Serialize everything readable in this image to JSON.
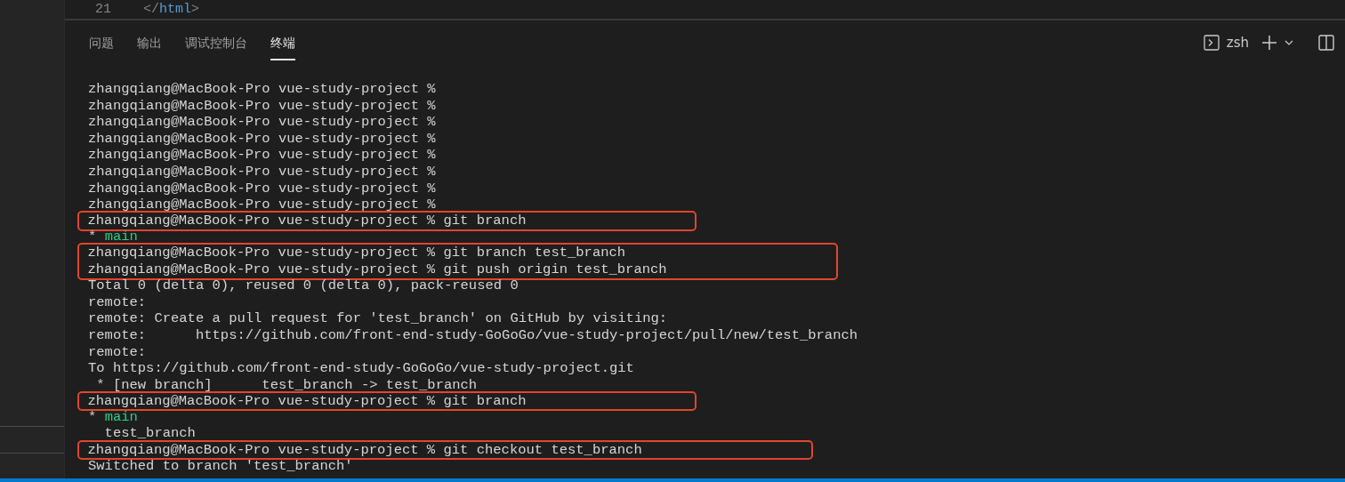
{
  "editor": {
    "line_number": "21",
    "code": [
      {
        "text": "</",
        "kind": "punct"
      },
      {
        "text": "html",
        "kind": "tag"
      },
      {
        "text": ">",
        "kind": "punct"
      }
    ]
  },
  "panel_tabs": [
    {
      "label": "问题",
      "selected": false
    },
    {
      "label": "输出",
      "selected": false
    },
    {
      "label": "调试控制台",
      "selected": false
    },
    {
      "label": "终端",
      "selected": true
    }
  ],
  "terminal_actions": {
    "shell": "zsh"
  },
  "terminal": {
    "blocks": [
      {
        "highlighted": false,
        "lines": [
          {
            "kind": "plain",
            "text": "zhangqiang@MacBook-Pro vue-study-project %"
          },
          {
            "kind": "plain",
            "text": "zhangqiang@MacBook-Pro vue-study-project %"
          },
          {
            "kind": "plain",
            "text": "zhangqiang@MacBook-Pro vue-study-project %"
          },
          {
            "kind": "plain",
            "text": "zhangqiang@MacBook-Pro vue-study-project %"
          },
          {
            "kind": "plain",
            "text": "zhangqiang@MacBook-Pro vue-study-project %"
          },
          {
            "kind": "plain",
            "text": "zhangqiang@MacBook-Pro vue-study-project %"
          },
          {
            "kind": "plain",
            "text": "zhangqiang@MacBook-Pro vue-study-project %"
          },
          {
            "kind": "plain",
            "text": "zhangqiang@MacBook-Pro vue-study-project %"
          }
        ]
      },
      {
        "highlighted": true,
        "lines": [
          {
            "kind": "plain",
            "text": "zhangqiang@MacBook-Pro vue-study-project % git branch"
          }
        ]
      },
      {
        "highlighted": false,
        "lines": [
          {
            "kind": "current_branch",
            "marker": "*",
            "text": "main"
          }
        ]
      },
      {
        "highlighted": true,
        "lines": [
          {
            "kind": "plain",
            "text": "zhangqiang@MacBook-Pro vue-study-project % git branch test_branch"
          },
          {
            "kind": "plain",
            "text": "zhangqiang@MacBook-Pro vue-study-project % git push origin test_branch"
          }
        ]
      },
      {
        "highlighted": false,
        "lines": [
          {
            "kind": "plain",
            "text": "Total 0 (delta 0), reused 0 (delta 0), pack-reused 0"
          },
          {
            "kind": "plain",
            "text": "remote:"
          },
          {
            "kind": "plain",
            "text": "remote: Create a pull request for 'test_branch' on GitHub by visiting:"
          },
          {
            "kind": "plain",
            "text": "remote:      https://github.com/front-end-study-GoGoGo/vue-study-project/pull/new/test_branch"
          },
          {
            "kind": "plain",
            "text": "remote:"
          },
          {
            "kind": "plain",
            "text": "To https://github.com/front-end-study-GoGoGo/vue-study-project.git"
          },
          {
            "kind": "plain",
            "text": " * [new branch]      test_branch -> test_branch"
          }
        ]
      },
      {
        "highlighted": true,
        "lines": [
          {
            "kind": "plain",
            "text": "zhangqiang@MacBook-Pro vue-study-project % git branch"
          }
        ]
      },
      {
        "highlighted": false,
        "lines": [
          {
            "kind": "current_branch",
            "marker": "*",
            "text": "main"
          },
          {
            "kind": "plain",
            "text": "  test_branch"
          }
        ]
      },
      {
        "highlighted": true,
        "lines": [
          {
            "kind": "plain",
            "text": "zhangqiang@MacBook-Pro vue-study-project % git checkout test_branch"
          }
        ]
      },
      {
        "highlighted": false,
        "lines": [
          {
            "kind": "plain",
            "text": "Switched to branch 'test_branch'"
          }
        ]
      }
    ]
  }
}
